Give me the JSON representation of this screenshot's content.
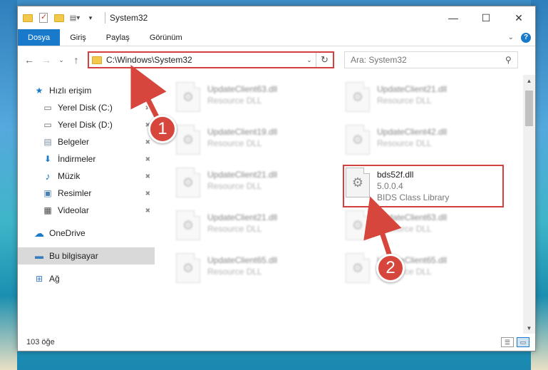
{
  "window": {
    "title": "System32",
    "controls": {
      "minimize": "—",
      "maximize": "☐",
      "close": "✕"
    }
  },
  "ribbon": {
    "tabs": [
      "Dosya",
      "Giriş",
      "Paylaş",
      "Görünüm"
    ],
    "collapse": "⌄",
    "help": "?"
  },
  "navbar": {
    "back": "←",
    "forward": "→",
    "recent": "⌄",
    "up": "↑",
    "address": "C:\\Windows\\System32",
    "address_dropdown": "⌄",
    "refresh": "↻",
    "search_placeholder": "Ara: System32",
    "search_icon": "⚲"
  },
  "sidebar": {
    "quick_access": {
      "label": "Hızlı erişim",
      "icon": "star-icon",
      "glyph": "★"
    },
    "items": [
      {
        "label": "Yerel Disk (C:)",
        "icon": "drive-icon",
        "glyph": "▭",
        "pinned": true
      },
      {
        "label": "Yerel Disk (D:)",
        "icon": "drive-icon",
        "glyph": "▭",
        "pinned": true
      },
      {
        "label": "Belgeler",
        "icon": "documents-icon",
        "glyph": "▤",
        "pinned": true
      },
      {
        "label": "İndirmeler",
        "icon": "download-icon",
        "glyph": "⬇",
        "pinned": true
      },
      {
        "label": "Müzik",
        "icon": "music-icon",
        "glyph": "♪",
        "pinned": true
      },
      {
        "label": "Resimler",
        "icon": "pictures-icon",
        "glyph": "▣",
        "pinned": true
      },
      {
        "label": "Videolar",
        "icon": "videos-icon",
        "glyph": "▦",
        "pinned": true
      }
    ],
    "onedrive": {
      "label": "OneDrive",
      "icon": "cloud-icon",
      "glyph": "☁"
    },
    "this_pc": {
      "label": "Bu bilgisayar",
      "icon": "computer-icon",
      "glyph": "▬"
    },
    "network": {
      "label": "Ağ",
      "icon": "network-icon",
      "glyph": "⊞"
    },
    "pin_glyph": "✚"
  },
  "files": [
    {
      "name": "UpdateClient63.dll",
      "desc": "Resource DLL"
    },
    {
      "name": "UpdateClient21.dll",
      "desc": "Resource DLL"
    },
    {
      "name": "UpdateClient19.dll",
      "desc": "Resource DLL"
    },
    {
      "name": "UpdateClient42.dll",
      "desc": "Resource DLL"
    },
    {
      "name": "UpdateClient21.dll",
      "desc": "Resource DLL"
    },
    {
      "name": "bds52f.dll",
      "version": "5.0.0.4",
      "desc": "BIDS Class Library"
    },
    {
      "name": "UpdateClient21.dll",
      "desc": "Resource DLL"
    },
    {
      "name": "UpdateClient63.dll",
      "desc": "Resource DLL"
    },
    {
      "name": "UpdateClient65.dll",
      "desc": "Resource DLL"
    },
    {
      "name": "UpdateClient65.dll",
      "desc": "Resource DLL"
    }
  ],
  "file_icon_glyph": "⚙",
  "status": {
    "item_count": "103 öğe"
  },
  "scrollbar": {
    "up": "▲",
    "down": "▼"
  },
  "callouts": {
    "one": "1",
    "two": "2"
  },
  "colors": {
    "accent": "#1979ca",
    "highlight": "#d43f3f",
    "badge": "#d6463c"
  }
}
